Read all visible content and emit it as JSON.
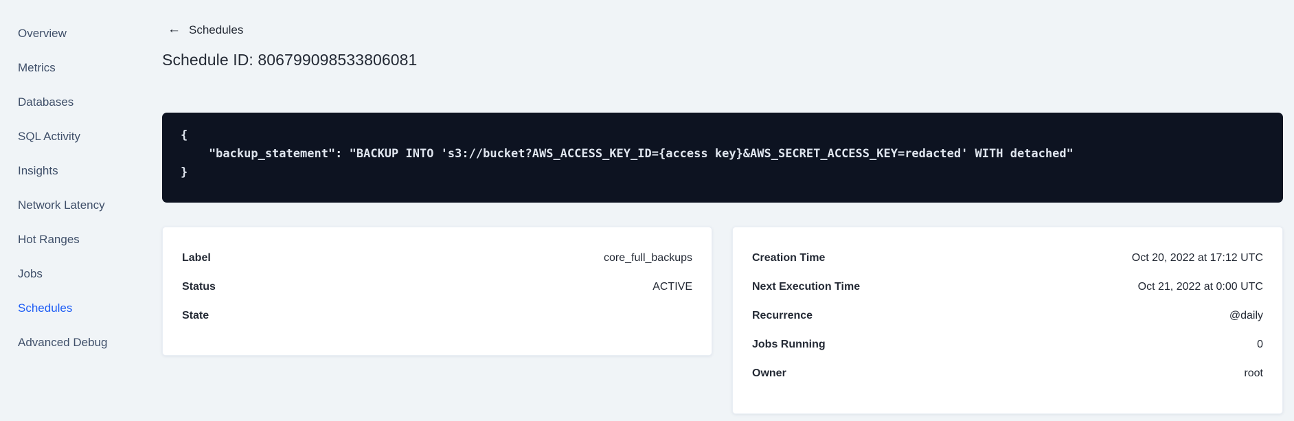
{
  "sidebar": {
    "items": [
      {
        "label": "Overview",
        "active": false
      },
      {
        "label": "Metrics",
        "active": false
      },
      {
        "label": "Databases",
        "active": false
      },
      {
        "label": "SQL Activity",
        "active": false
      },
      {
        "label": "Insights",
        "active": false
      },
      {
        "label": "Network Latency",
        "active": false
      },
      {
        "label": "Hot Ranges",
        "active": false
      },
      {
        "label": "Jobs",
        "active": false
      },
      {
        "label": "Schedules",
        "active": true
      },
      {
        "label": "Advanced Debug",
        "active": false
      }
    ]
  },
  "header": {
    "back_label": "Schedules",
    "title": "Schedule ID: 806799098533806081"
  },
  "icons": {
    "back_arrow": "←"
  },
  "code_block": {
    "lines": [
      "{",
      "    \"backup_statement\": \"BACKUP INTO 's3://bucket?AWS_ACCESS_KEY_ID={access key}&AWS_SECRET_ACCESS_KEY=redacted' WITH detached\"",
      "}"
    ]
  },
  "cards": {
    "details": {
      "rows": [
        {
          "label": "Label",
          "value": "core_full_backups"
        },
        {
          "label": "Status",
          "value": "ACTIVE"
        },
        {
          "label": "State",
          "value": ""
        }
      ]
    },
    "schedule": {
      "rows": [
        {
          "label": "Creation Time",
          "value": "Oct 20, 2022 at 17:12 UTC"
        },
        {
          "label": "Next Execution Time",
          "value": "Oct 21, 2022 at 0:00 UTC"
        },
        {
          "label": "Recurrence",
          "value": "@daily"
        },
        {
          "label": "Jobs Running",
          "value": "0"
        },
        {
          "label": "Owner",
          "value": "root"
        }
      ]
    }
  },
  "colors": {
    "page_bg": "#f0f4f7",
    "card_bg": "#ffffff",
    "code_bg": "#0d1321",
    "code_text": "#dfe5ee",
    "accent_blue": "#1f5ef5",
    "text_dark": "#242a35",
    "sidebar_text": "#40506a"
  }
}
